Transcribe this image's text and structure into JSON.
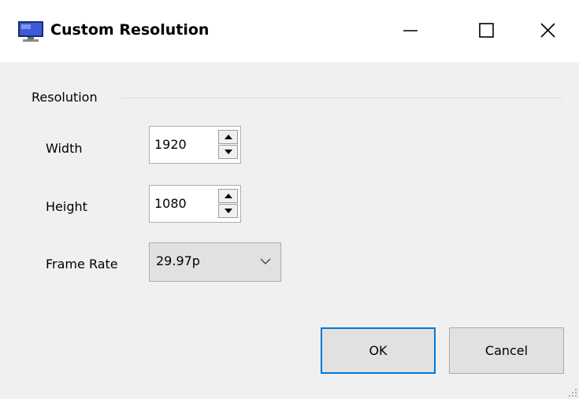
{
  "window": {
    "title": "Custom Resolution"
  },
  "group": {
    "label": "Resolution"
  },
  "fields": {
    "width_label": "Width",
    "width_value": "1920",
    "height_label": "Height",
    "height_value": "1080",
    "frame_rate_label": "Frame Rate",
    "frame_rate_value": "29.97p"
  },
  "buttons": {
    "ok": "OK",
    "cancel": "Cancel"
  },
  "icons": {
    "app": "monitor-icon",
    "minimize": "minimize-icon",
    "maximize": "maximize-icon",
    "close": "close-icon",
    "spin_up": "arrow-up-icon",
    "spin_down": "arrow-down-icon",
    "dropdown": "chevron-down-icon",
    "grip": "resize-grip-icon"
  },
  "colors": {
    "dialog_bg": "#f0f0f0",
    "title_bg": "#ffffff",
    "focus_accent": "#0078d7",
    "button_bg": "#e1e1e1"
  }
}
